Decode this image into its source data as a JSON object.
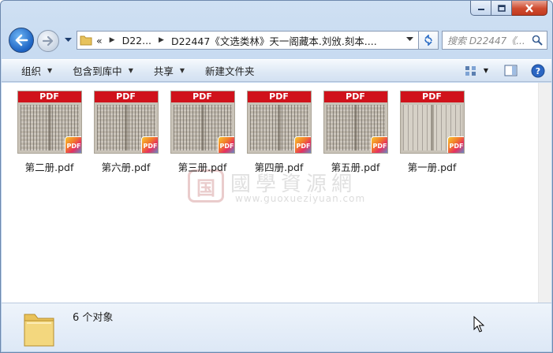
{
  "window": {
    "caption_buttons": [
      "minimize",
      "maximize",
      "close"
    ]
  },
  "navigation": {
    "back_icon": "back-arrow-icon",
    "forward_icon": "forward-arrow-icon",
    "address": {
      "overflow_marker": "«",
      "segments": [
        "D22...",
        "D22447《文选类林》天一阁藏本.刘攽.刻本...."
      ]
    },
    "search_placeholder": "搜索 D22447《..."
  },
  "toolbar": {
    "organize": "组织",
    "include_in_library": "包含到库中",
    "share": "共享",
    "new_folder": "新建文件夹"
  },
  "files": [
    {
      "name": "第二册.pdf",
      "banner": "PDF",
      "badge": "PDF"
    },
    {
      "name": "第六册.pdf",
      "banner": "PDF",
      "badge": "PDF"
    },
    {
      "name": "第三册.pdf",
      "banner": "PDF",
      "badge": "PDF"
    },
    {
      "name": "第四册.pdf",
      "banner": "PDF",
      "badge": "PDF"
    },
    {
      "name": "第五册.pdf",
      "banner": "PDF",
      "badge": "PDF"
    },
    {
      "name": "第一册.pdf",
      "banner": "PDF",
      "badge": "PDF"
    }
  ],
  "watermark": {
    "seal": "国",
    "title": "國學資源網",
    "url": "www.guoxueziyuan.com"
  },
  "details": {
    "count_text": "6 个对象"
  },
  "colors": {
    "pdf_banner": "#d0121b",
    "chrome": "#bcd3ee",
    "close_button": "#cf4b2f"
  }
}
